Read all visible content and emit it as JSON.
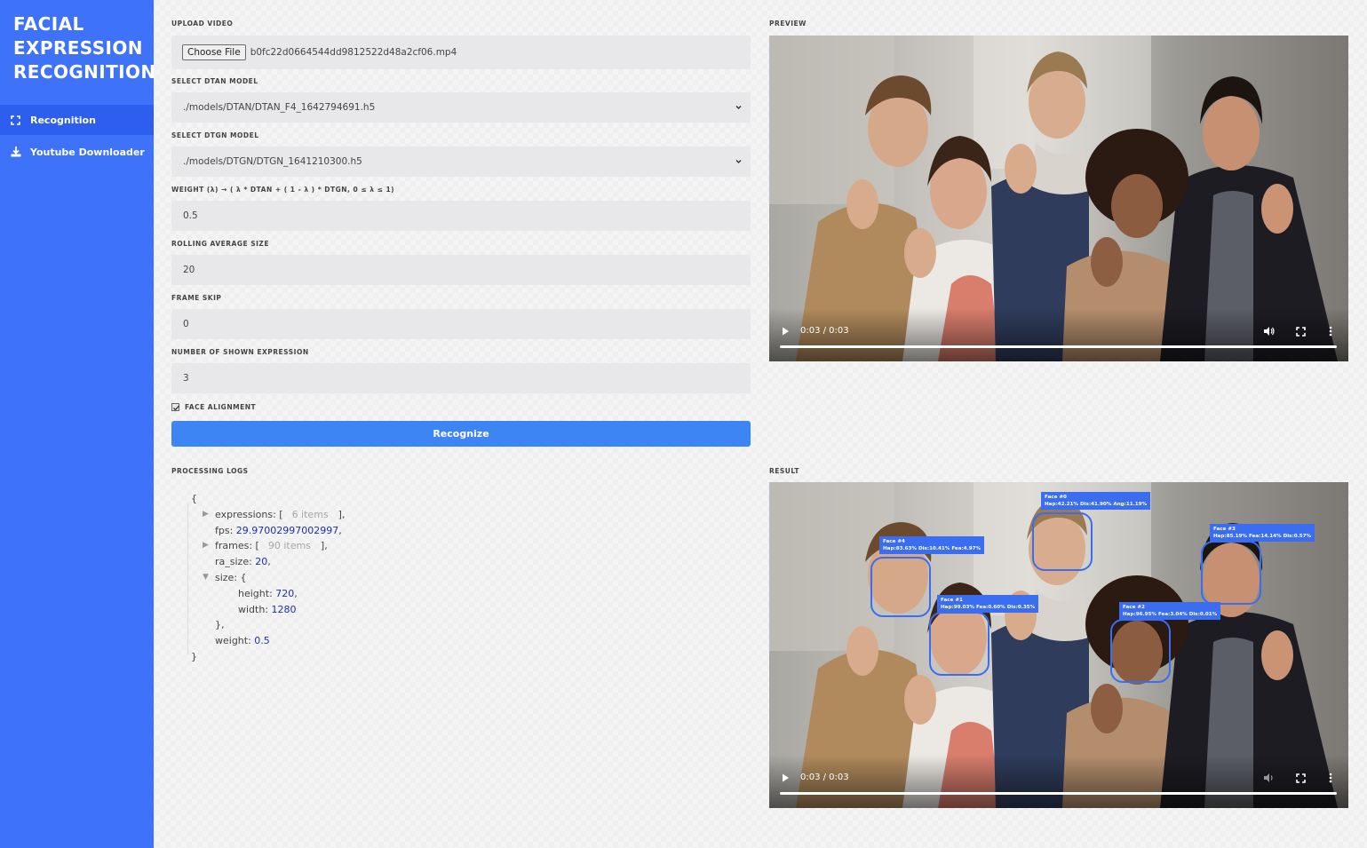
{
  "sidebar": {
    "brand": [
      "FACIAL",
      "EXPRESSION",
      "RECOGNITION"
    ],
    "items": [
      {
        "label": "Recognition",
        "icon": "focus-frame-icon",
        "active": true
      },
      {
        "label": "Youtube Downloader",
        "icon": "download-icon",
        "active": false
      }
    ],
    "accent": "#3d72f9"
  },
  "form": {
    "upload_label": "UPLOAD VIDEO",
    "choose_file": "Choose File",
    "file_name": "b0fc22d0664544dd9812522d48a2cf06.mp4",
    "dtan_label": "SELECT DTAN MODEL",
    "dtan_value": "./models/DTAN/DTAN_F4_1642794691.h5",
    "dtgn_label": "SELECT DTGN MODEL",
    "dtgn_value": "./models/DTGN/DTGN_1641210300.h5",
    "weight_label": "WEIGHT (λ) → ( λ * DTAN + ( 1 - λ ) * DTGN, 0 ≤ λ ≤ 1)",
    "weight_value": "0.5",
    "rolling_label": "ROLLING AVERAGE SIZE",
    "rolling_value": "20",
    "frame_skip_label": "FRAME SKIP",
    "frame_skip_value": "0",
    "shown_expr_label": "NUMBER OF SHOWN EXPRESSION",
    "shown_expr_value": "3",
    "face_alignment_label": "FACE ALIGNMENT",
    "face_alignment_checked": true,
    "recognize_button": "Recognize",
    "button_color": "#3d85f5"
  },
  "logs": {
    "label": "PROCESSING LOGS",
    "open_brace": "{",
    "close_brace": "}",
    "expressions_key": "expressions: [",
    "expressions_count": "6 items",
    "expressions_end": "],",
    "fps_key": "fps: ",
    "fps_value": "29.97002997002997",
    "frames_key": "frames: [",
    "frames_count": "90 items",
    "frames_end": "],",
    "ra_size_key": "ra_size: ",
    "ra_size_value": "20",
    "size_key": "size: {",
    "height_key": "height: ",
    "height_value": "720",
    "width_key": "width: ",
    "width_value": "1280",
    "size_end": "},",
    "weight_key": "weight: ",
    "weight_value": "0.5",
    "comma": ","
  },
  "preview": {
    "label": "PREVIEW",
    "time": "0:03 / 0:03"
  },
  "result": {
    "label": "RESULT",
    "time": "0:03 / 0:03",
    "faces": [
      {
        "tag_line1": "Face #0",
        "tag_line2": "Hap:42.21% Dis:41.90% Ang:11.19%"
      },
      {
        "tag_line1": "Face #1",
        "tag_line2": "Hap:99.03% Fea:0.60% Dis:0.35%"
      },
      {
        "tag_line1": "Face #2",
        "tag_line2": "Hap:96.95% Fea:3.04% Dis:0.01%"
      },
      {
        "tag_line1": "Face #3",
        "tag_line2": "Hap:85.19% Fea:14.14% Dis:0.57%"
      },
      {
        "tag_line1": "Face #4",
        "tag_line2": "Hap:83.63% Dis:10.41% Fea:4.97%"
      }
    ],
    "box_color": "#3a6df0"
  }
}
